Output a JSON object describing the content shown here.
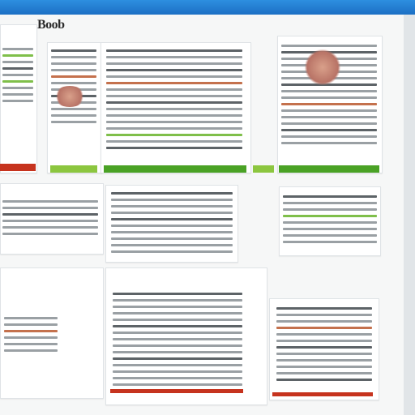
{
  "site": {
    "logo_text": "Boob"
  },
  "colors": {
    "titlebar": "#1c6fc4",
    "accent_green": "#8cc63f",
    "accent_red": "#c6331e"
  }
}
